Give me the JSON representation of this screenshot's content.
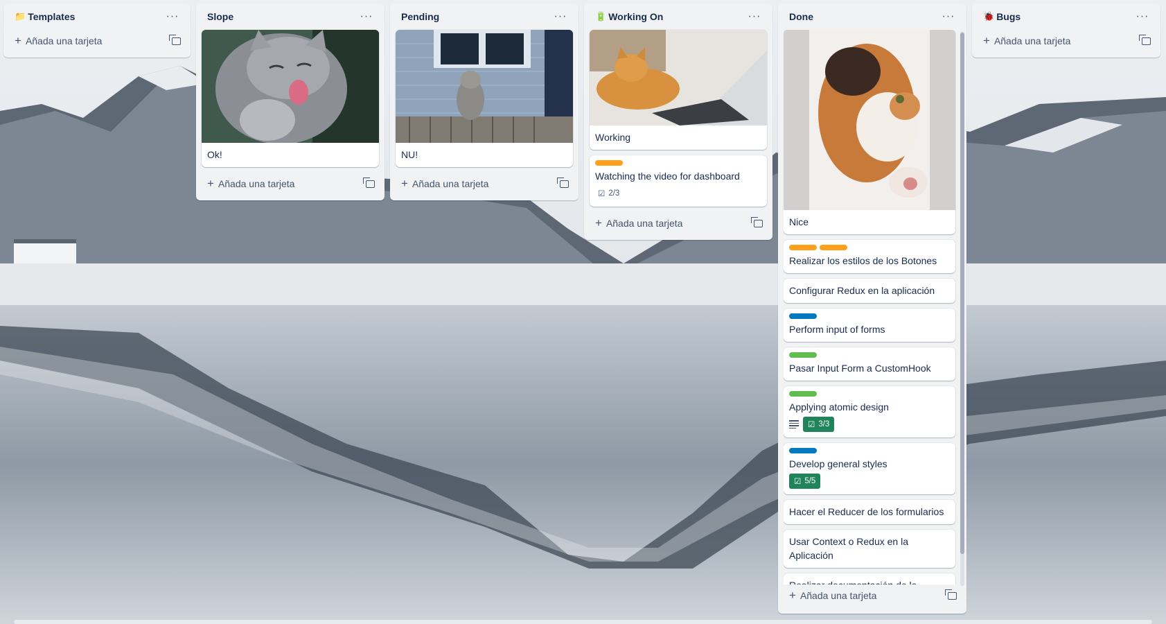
{
  "colors": {
    "list_bg": "#f1f2f4",
    "label_orange": "#ff9f1a",
    "label_blue": "#0079bf",
    "label_green": "#61bd4f",
    "badge_done": "#1f845a"
  },
  "add_card_label": "Añada una tarjeta",
  "lists": [
    {
      "emoji": "📁",
      "title": "Templates",
      "cards": []
    },
    {
      "emoji": "",
      "title": "Slope",
      "cards": [
        {
          "title": "Ok!",
          "cover": "gray cat licking paw"
        }
      ]
    },
    {
      "emoji": "",
      "title": "Pending",
      "cards": [
        {
          "title": "NU!",
          "cover": "gray cat on wooden fence"
        }
      ]
    },
    {
      "emoji": "🔋",
      "title": "Working On",
      "cards": [
        {
          "title": "Working",
          "cover": "ginger cat beside laptop"
        },
        {
          "title": "Watching the video for dashboard",
          "labels": [
            "orange"
          ],
          "checklist": "2/3"
        }
      ]
    },
    {
      "emoji": "",
      "title": "Done",
      "cards": [
        {
          "title": "Nice",
          "cover": "calico cat lying on bed"
        },
        {
          "title": "Realizar los estilos de los Botones",
          "labels": [
            "orange",
            "orange"
          ]
        },
        {
          "title": "Configurar Redux en la aplicación"
        },
        {
          "title": "Perform input of forms",
          "labels": [
            "blue"
          ]
        },
        {
          "title": "Pasar Input Form a CustomHook",
          "labels": [
            "green"
          ]
        },
        {
          "title": "Applying atomic design",
          "labels": [
            "green"
          ],
          "has_description": true,
          "checklist": "3/3"
        },
        {
          "title": "Develop general styles",
          "labels": [
            "blue"
          ],
          "checklist": "5/5"
        },
        {
          "title": "Hacer el Reducer de los formularios"
        },
        {
          "title": "Usar Context o Redux en la Aplicación"
        },
        {
          "title": "Realizar documentación de la implementación"
        }
      ]
    },
    {
      "emoji": "🐞",
      "title": "Bugs",
      "cards": []
    }
  ]
}
